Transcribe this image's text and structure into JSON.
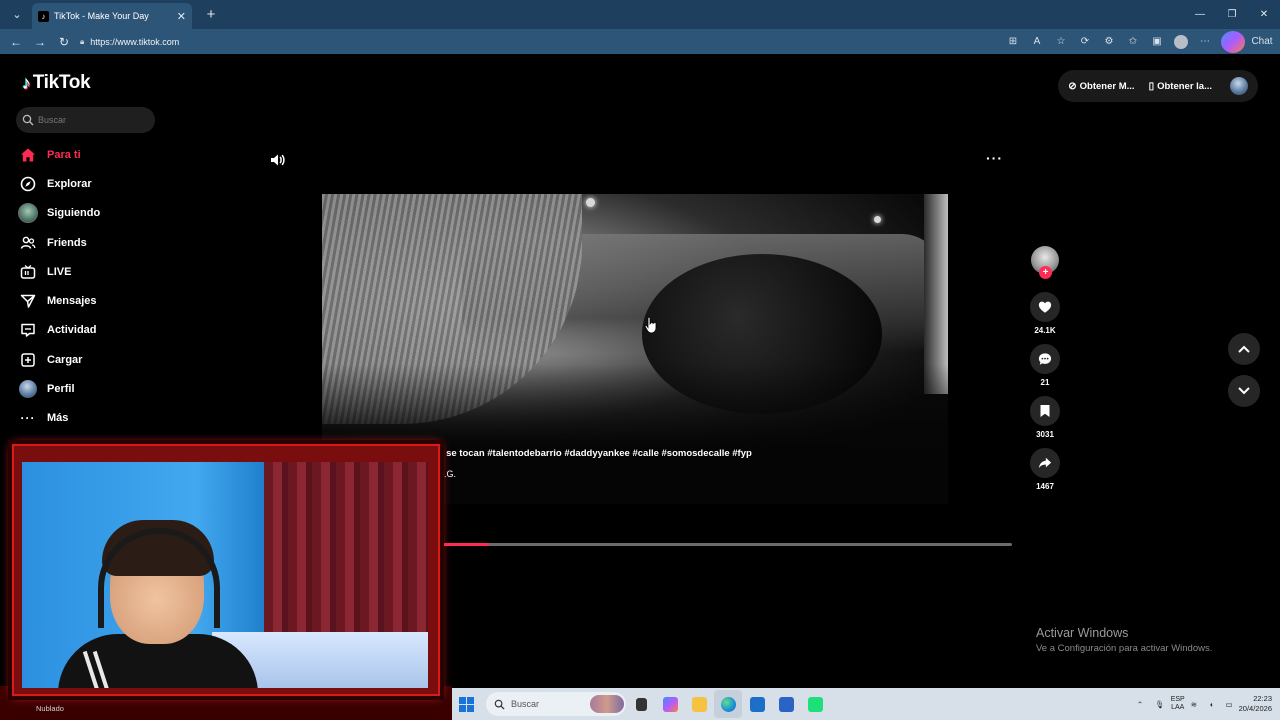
{
  "browser": {
    "tab_title": "TikTok - Make Your Day",
    "url": "https://www.tiktok.com",
    "chat_label": "Chat"
  },
  "tiktok": {
    "logo_text": "TikTok",
    "search_placeholder": "Buscar",
    "nav": [
      {
        "label": "Para ti",
        "icon": "home-icon",
        "active": true
      },
      {
        "label": "Explorar",
        "icon": "compass-icon"
      },
      {
        "label": "Siguiendo",
        "icon": "following-avatar"
      },
      {
        "label": "Friends",
        "icon": "friends-icon"
      },
      {
        "label": "LIVE",
        "icon": "live-icon"
      },
      {
        "label": "Mensajes",
        "icon": "messages-icon"
      },
      {
        "label": "Actividad",
        "icon": "activity-icon"
      },
      {
        "label": "Cargar",
        "icon": "upload-icon"
      },
      {
        "label": "Perfil",
        "icon": "profile-avatar"
      },
      {
        "label": "Más",
        "icon": "more-icon"
      }
    ],
    "top_buttons": {
      "get_coins": "Obtener M...",
      "get_app": "Obtener la..."
    },
    "video": {
      "caption": "s    e no se tocan #talentodebarrio #daddyyankee #calle #somosdecalle #fyp",
      "music": "ous B.I.G.",
      "progress": 0.11,
      "likes": "24.1K",
      "comments": "21",
      "saves": "3031",
      "shares": "1467"
    }
  },
  "windows": {
    "activate_title": "Activar Windows",
    "activate_subtitle": "Ve a Configuración para activar Windows.",
    "weather": "Nublado",
    "taskbar_search": "Buscar",
    "lang_top": "ESP",
    "lang_bottom": "LAA",
    "time": "22:23",
    "date": "20/4/2026"
  },
  "colors": {
    "accent": "#fe2c55",
    "browser_tab_bar": "#1e3f5d",
    "browser_address_bar": "#2d5577",
    "cam_border": "#d71b1b"
  }
}
